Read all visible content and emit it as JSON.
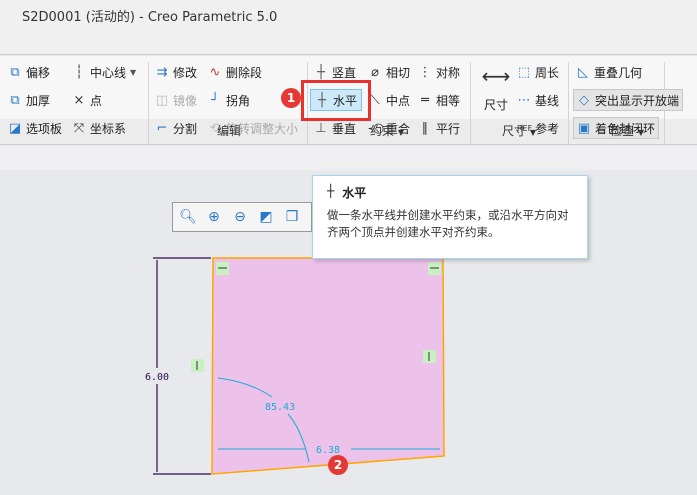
{
  "title": "S2D0001 (活动的) - Creo Parametric 5.0",
  "ribbon": {
    "col1": [
      "偏移",
      "加厚",
      "选项板"
    ],
    "col2": [
      "中心线",
      "点",
      "坐标系"
    ],
    "edit1": [
      "修改",
      "镜像",
      "分割"
    ],
    "edit2": [
      "删除段",
      "拐角",
      "旋转调整大小"
    ],
    "con1": [
      "竖直",
      "水平",
      "垂直"
    ],
    "con2": [
      "相切",
      "中点",
      "重合"
    ],
    "con3": [
      "对称",
      "相等",
      "平行"
    ],
    "dim_big": "尺寸",
    "dim2": [
      "周长",
      "基线",
      "参考"
    ],
    "check": [
      "重叠几何",
      "突出显示开放端",
      "着色封闭环"
    ],
    "groups": {
      "edit": "编辑",
      "constraint": "约束",
      "dimension": "尺寸",
      "check": "检查"
    }
  },
  "badges": {
    "one": "1",
    "two": "2"
  },
  "tooltip": {
    "title": "水平",
    "desc": "做一条水平线并创建水平约束，或沿水平方向对齐两个顶点并创建水平对齐约束。"
  },
  "sketch": {
    "height_dim": "6.00",
    "angle_dim": "85.43",
    "width_dim": "6.38"
  },
  "colors": {
    "fill": "#ecc2ea",
    "edge": "#ffa500",
    "dim": "#1aa9d8",
    "highlight": "#e8302c"
  }
}
